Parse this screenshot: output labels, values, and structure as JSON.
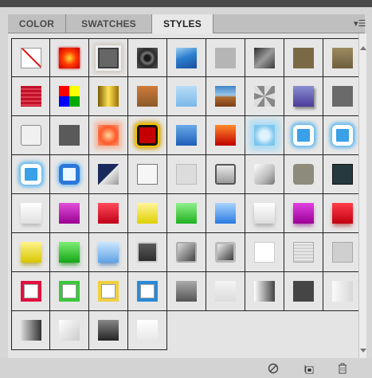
{
  "tabs": [
    {
      "label": "COLOR",
      "active": false
    },
    {
      "label": "SWATCHES",
      "active": false
    },
    {
      "label": "STYLES",
      "active": true
    }
  ],
  "panel_menu_icon": "panel-menu-icon",
  "styles": [
    "none",
    "red-glow",
    "gray-glow",
    "dark-ring",
    "blue-split",
    "lightgray",
    "metal",
    "bronze",
    "khaki",
    "stripes",
    "multi",
    "gold",
    "wood",
    "lightblue",
    "sunset",
    "noise",
    "purple",
    "gray5",
    "outline",
    "darkgray",
    "orange-glow",
    "fire",
    "blue-gel",
    "red-orange",
    "frost",
    "blue-ring",
    "blue-ring",
    "blue-ring",
    "blue-ring2",
    "navy-diag",
    "white-box",
    "gray-outline",
    "bevel-gray",
    "pillow",
    "stone",
    "teal-dark",
    "white-gel",
    "magenta-gel",
    "red-gel",
    "yellow-gel",
    "green-gel",
    "blue-gel2",
    "white-shine",
    "magenta-drop",
    "red-drop",
    "yellow-drop",
    "green-drop",
    "lightblue-drop",
    "gray-emboss",
    "gray-emboss2",
    "gray-emboss3",
    "white-flat",
    "lines",
    "soft-gray",
    "frame-red",
    "frame-green",
    "frame-yellow",
    "frame-blue",
    "grad-dark",
    "grad-light",
    "grad-h",
    "dark-flat",
    "grad-hl",
    "grad-hd",
    "grad-fade",
    "grad-dark2",
    "grad-white"
  ],
  "bottom_icons": [
    "no-style-icon",
    "new-style-icon",
    "trash-icon"
  ]
}
